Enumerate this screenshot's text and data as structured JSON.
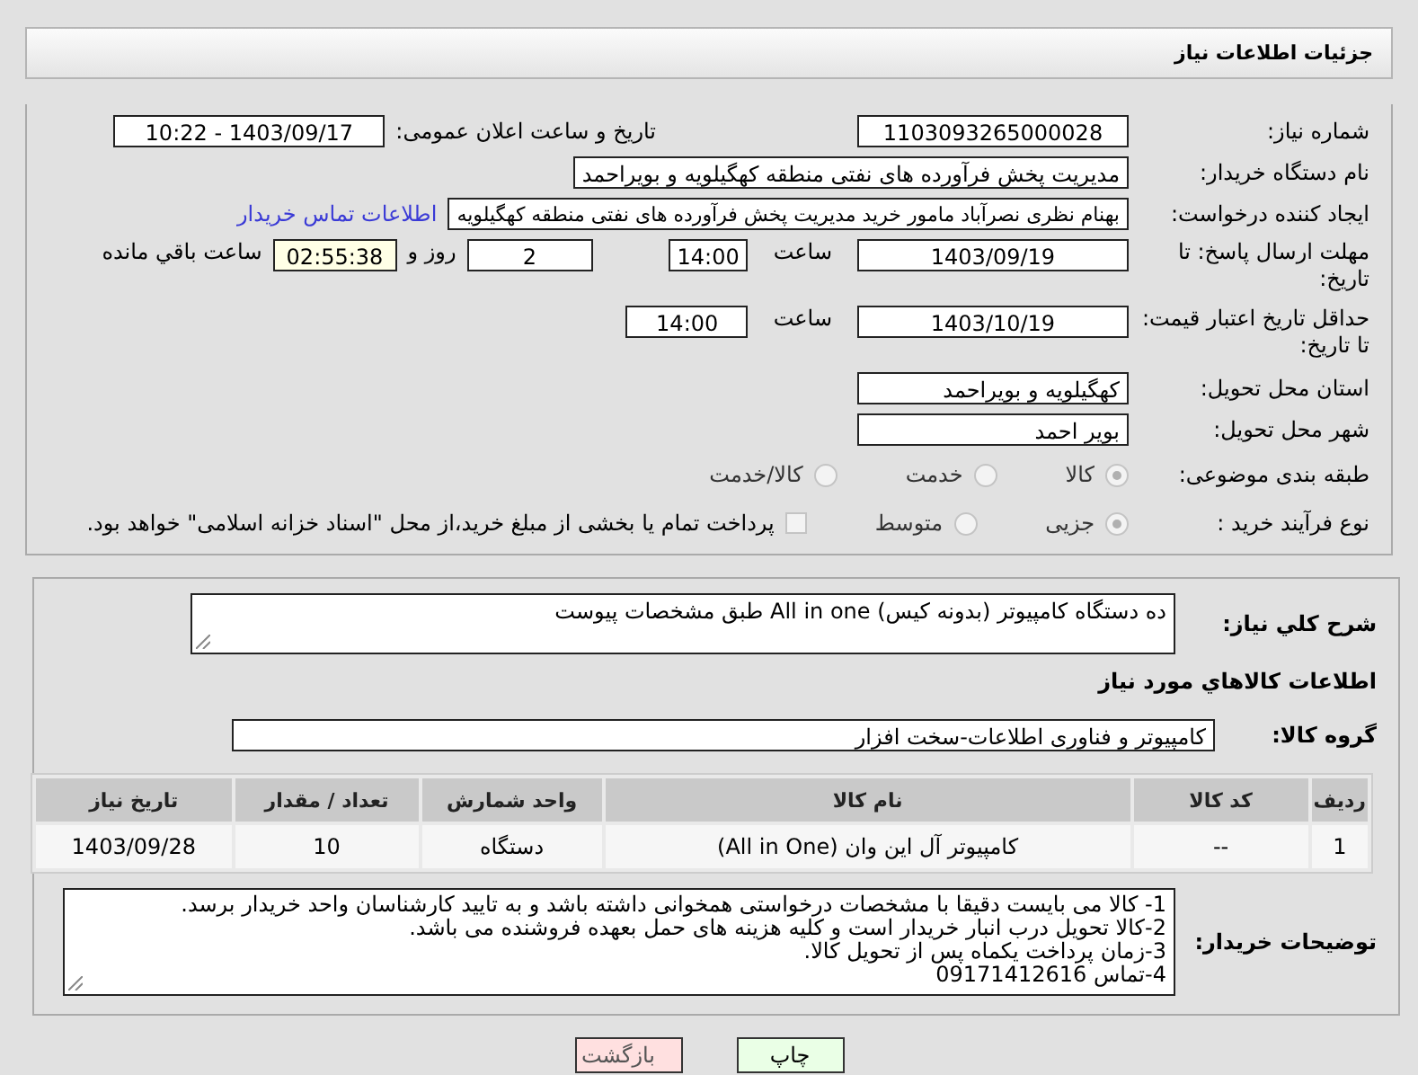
{
  "header": {
    "title": "جزئیات اطلاعات نیاز"
  },
  "need_number": {
    "label": "شماره نیاز:",
    "value": "1103093265000028"
  },
  "announce": {
    "label": "تاریخ و ساعت اعلان عمومی:",
    "value": "1403/09/17 - 10:22"
  },
  "buyer": {
    "label": "نام دستگاه خریدار:",
    "value": "مدیریت پخش فرآورده های نفتی منطقه کهگیلویه و بویراحمد"
  },
  "requester": {
    "label": "ایجاد کننده درخواست:",
    "value": "بهنام نظری نصرآباد مامور خرید مدیریت پخش فرآورده های نفتی منطقه کهگیلویه",
    "link": "اطلاعات تماس خریدار"
  },
  "deadline": {
    "label": "مهلت ارسال پاسخ: تا تاریخ:",
    "date": "1403/09/19",
    "time_label": "ساعت",
    "time": "14:00",
    "days": "2",
    "days_label": "روز و",
    "remaining": "02:55:38",
    "remaining_label": "ساعت باقي مانده"
  },
  "validity": {
    "label": "حداقل تاریخ اعتبار قیمت: تا تاریخ:",
    "date": "1403/10/19",
    "time_label": "ساعت",
    "time": "14:00"
  },
  "province": {
    "label": "استان محل تحویل:",
    "value": "کهگیلویه و بویراحمد"
  },
  "city": {
    "label": "شهر محل تحویل:",
    "value": "بویر احمد"
  },
  "category": {
    "label": "طبقه بندی موضوعی:",
    "options": [
      {
        "label": "کالا",
        "selected": true
      },
      {
        "label": "خدمت",
        "selected": false
      },
      {
        "label": "کالا/خدمت",
        "selected": false
      }
    ]
  },
  "purchase_type": {
    "label": "نوع فرآیند خرید :",
    "options": [
      {
        "label": "جزیی",
        "selected": true
      },
      {
        "label": "متوسط",
        "selected": false
      }
    ],
    "payment": {
      "checked": false,
      "text": "پرداخت تمام یا بخشی از مبلغ خرید،از محل \"اسناد خزانه اسلامی\" خواهد بود."
    }
  },
  "description": {
    "label": "شرح کلي نياز:",
    "value": "ده دستگاه کامپیوتر (بدونه کیس) All in one طبق مشخصات پیوست"
  },
  "goods_section": {
    "title": "اطلاعات کالاهاي مورد نياز"
  },
  "goods_group": {
    "label": "گروه کالا:",
    "value": "کامپیوتر و فناوری اطلاعات-سخت افزار"
  },
  "table": {
    "columns": [
      "ردیف",
      "کد کالا",
      "نام کالا",
      "واحد شمارش",
      "تعداد / مقدار",
      "تاریخ نیاز"
    ],
    "rows": [
      [
        "1",
        "--",
        "کامپیوتر آل این وان (All in One)",
        "دستگاه",
        "10",
        "1403/09/28"
      ]
    ]
  },
  "buyer_notes": {
    "label": "توضیحات خریدار:",
    "lines": [
      "1- کالا می بایست دقیقا با مشخصات درخواستی همخوانی داشته باشد و به تایید کارشناسان واحد خریدار برسد.",
      "2-کالا تحویل درب انبار خریدار است و کلیه هزینه های حمل بعهده فروشنده می باشد.",
      "3-زمان پرداخت یکماه پس از تحویل کالا.",
      "4-تماس 09171412616"
    ]
  },
  "buttons": [
    {
      "label": "چاپ",
      "kind": "print"
    },
    {
      "label": "بازگشت",
      "kind": "back"
    }
  ]
}
